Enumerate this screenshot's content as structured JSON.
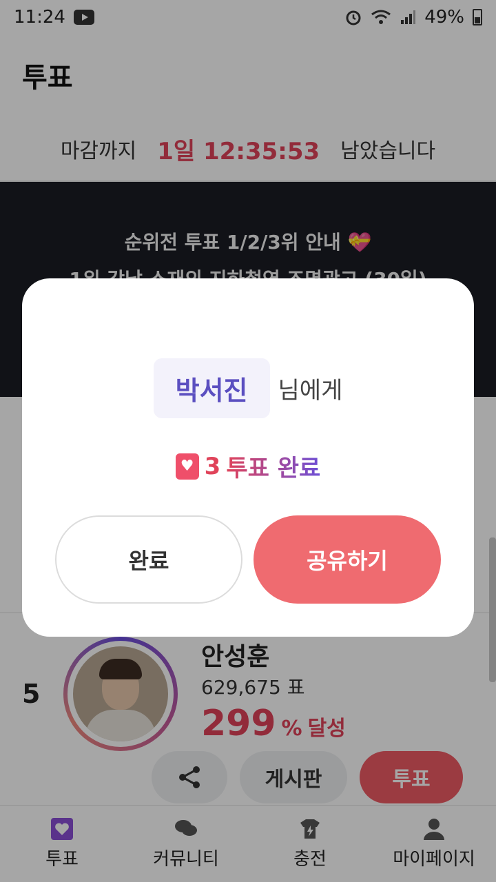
{
  "status_bar": {
    "time": "11:24",
    "battery": "49%"
  },
  "header": {
    "title": "투표"
  },
  "deadline": {
    "prefix": "마감까지",
    "timer": "1일 12:35:53",
    "suffix": "남았습니다"
  },
  "banner": {
    "line1": "순위전 투표 1/2/3위 안내 💝",
    "line2": "1위 강남 소재의 지하철역 조명광고 (30일)"
  },
  "candidate": {
    "rank": "5",
    "name": "안성훈",
    "votes": "629,675 표",
    "percent": "299",
    "percent_unit": "%",
    "percent_suffix": "달성",
    "board_label": "게시판",
    "vote_label": "투표"
  },
  "dialog": {
    "recipient": "박서진",
    "recipient_suffix": "님에게",
    "count": "3",
    "result_text": "투표 완료",
    "done_label": "완료",
    "share_label": "공유하기"
  },
  "bottom_nav": [
    {
      "label": "투표",
      "icon": "vote-icon"
    },
    {
      "label": "커뮤니티",
      "icon": "community-icon"
    },
    {
      "label": "충전",
      "icon": "charge-icon"
    },
    {
      "label": "마이페이지",
      "icon": "profile-icon"
    }
  ],
  "colors": {
    "accent": "#e0435a",
    "share_button": "#ef6b70",
    "purple": "#5b4fc0"
  }
}
